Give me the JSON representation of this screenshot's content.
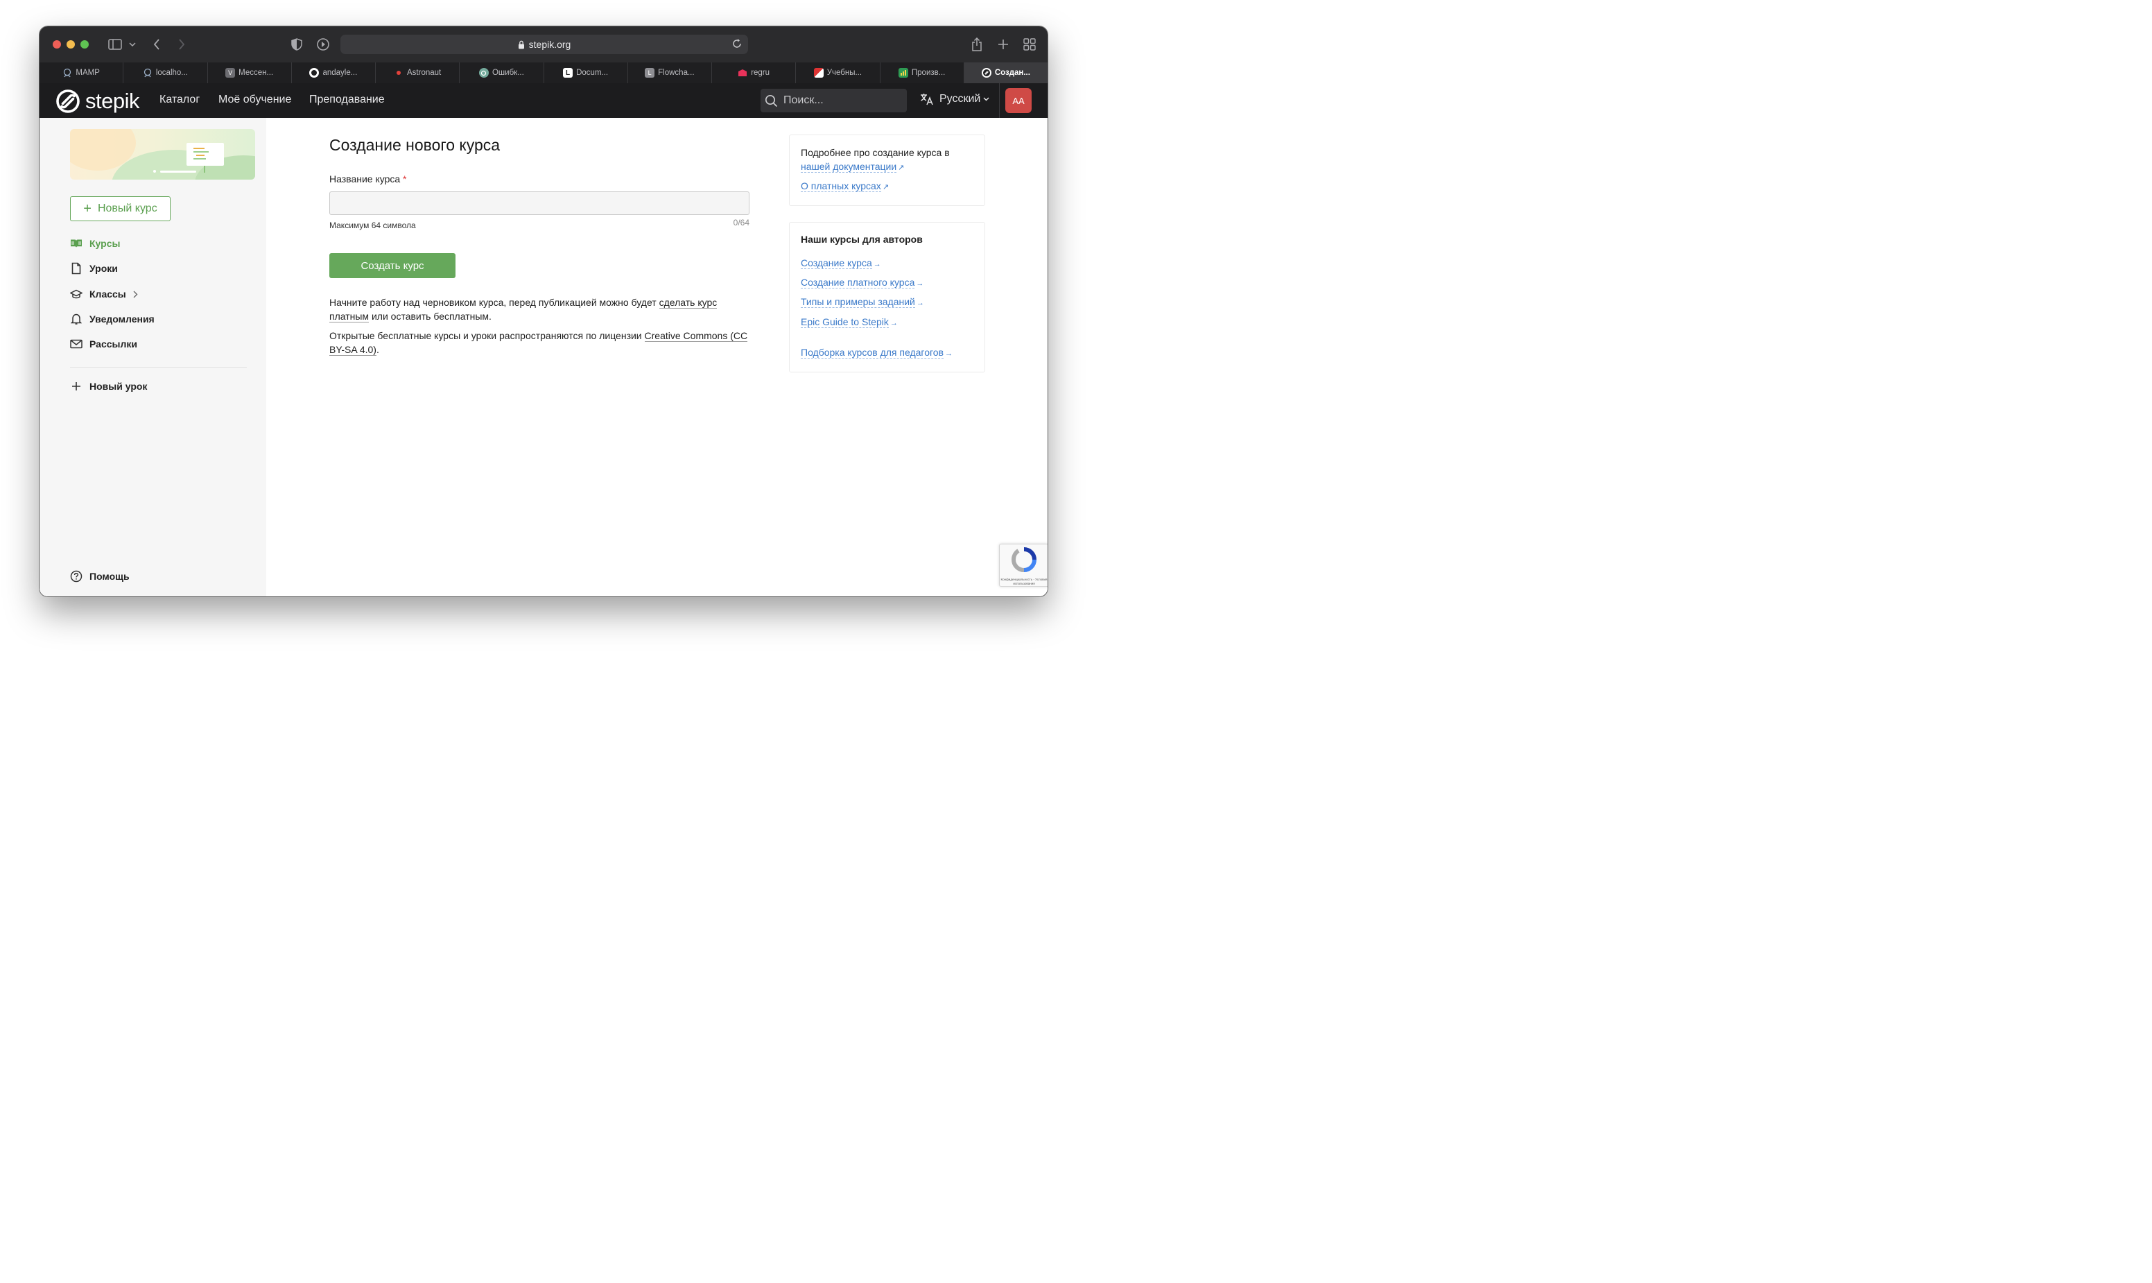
{
  "browser": {
    "address": "stepik.org",
    "tabs": [
      {
        "label": "MAMP",
        "favicon": "mamp-icon",
        "active": false
      },
      {
        "label": "localho...",
        "favicon": "mamp-icon",
        "active": false
      },
      {
        "label": "Мессен...",
        "favicon": "v-icon",
        "active": false
      },
      {
        "label": "andayle...",
        "favicon": "github-icon",
        "active": false
      },
      {
        "label": "Astronaut",
        "favicon": "red-dot-icon",
        "active": false
      },
      {
        "label": "Ошибк...",
        "favicon": "openai-icon",
        "active": false
      },
      {
        "label": "Docum...",
        "favicon": "document-icon",
        "active": false
      },
      {
        "label": "Flowcha...",
        "favicon": "l-icon",
        "active": false
      },
      {
        "label": "regru",
        "favicon": "regru-icon",
        "active": false
      },
      {
        "label": "Учебны...",
        "favicon": "flag-icon",
        "active": false
      },
      {
        "label": "Произв...",
        "favicon": "chart-icon",
        "active": false
      },
      {
        "label": "Создан...",
        "favicon": "stepik-icon",
        "active": true
      }
    ]
  },
  "header": {
    "logo": "stepik",
    "nav": {
      "catalog": "Каталог",
      "my_learning": "Моё обучение",
      "teaching": "Преподавание"
    },
    "search_placeholder": "Поиск...",
    "language": "Русский",
    "avatar_initials": "AA"
  },
  "sidebar": {
    "new_course": "Новый курс",
    "items": [
      {
        "label": "Курсы",
        "icon": "book-icon",
        "active": true
      },
      {
        "label": "Уроки",
        "icon": "document-icon",
        "active": false
      },
      {
        "label": "Классы",
        "icon": "graduation-cap-icon",
        "active": false
      },
      {
        "label": "Уведомления",
        "icon": "bell-icon",
        "active": false
      },
      {
        "label": "Рассылки",
        "icon": "mail-icon",
        "active": false
      }
    ],
    "new_lesson": "Новый урок",
    "help": "Помощь"
  },
  "main": {
    "title": "Создание нового курса",
    "field_label": "Название курса",
    "required_mark": "*",
    "input_value": "",
    "hint": "Максимум 64 символа",
    "counter": "0/64",
    "create_button": "Создать курс",
    "para1": {
      "text_before": "Начните работу над черновиком курса, перед публикацией можно будет ",
      "link": "сделать курс платным",
      "text_after": " или оставить бесплатным."
    },
    "para2": {
      "text_before": "Открытые бесплатные курсы и уроки распространяются по лицензии ",
      "link": "Creative Commons (CC BY-SA 4.0)",
      "text_after": "."
    }
  },
  "right": {
    "card1": {
      "text": "Подробнее про создание курса в",
      "link1": "нашей документации",
      "link2": "О платных курсах"
    },
    "card2": {
      "title": "Наши курсы для авторов",
      "links": [
        "Создание курса",
        "Создание платного курса",
        "Типы и примеры заданий",
        "Epic Guide to Stepik",
        "Подборка курсов для педагогов"
      ]
    }
  },
  "recaptcha": {
    "text": "Конфиденциальность - Условия использования"
  },
  "colors": {
    "accent_green": "#66a85b",
    "link_blue": "#3a79c9",
    "header_bg": "#1c1c1e",
    "avatar_bg": "#cf4a46"
  }
}
